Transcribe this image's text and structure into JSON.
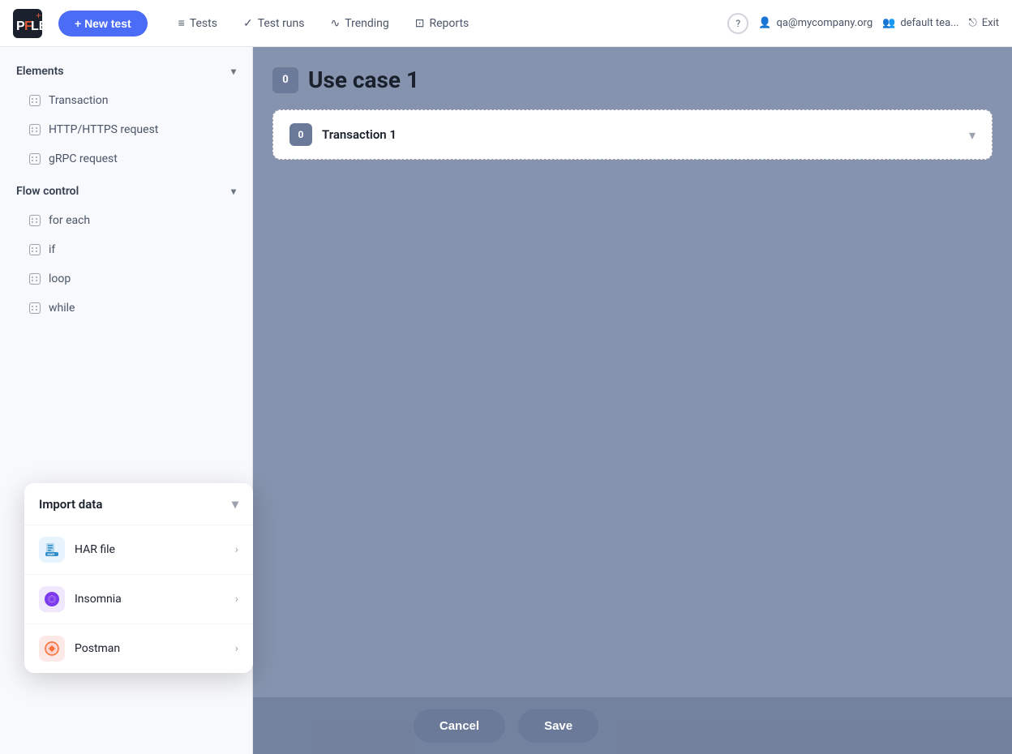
{
  "topnav": {
    "logo_text": "PFLB",
    "new_test_label": "+ New test",
    "nav_items": [
      {
        "id": "tests",
        "label": "Tests",
        "icon": "≡"
      },
      {
        "id": "test-runs",
        "label": "Test runs",
        "icon": "✓"
      },
      {
        "id": "trending",
        "label": "Trending",
        "icon": "∿"
      },
      {
        "id": "reports",
        "label": "Reports",
        "icon": "⊡"
      }
    ],
    "right_items": [
      {
        "id": "help",
        "label": "?",
        "type": "circle"
      },
      {
        "id": "user",
        "label": "qa@mycompany.org",
        "icon": "👤"
      },
      {
        "id": "team",
        "label": "default tea...",
        "icon": "👥"
      },
      {
        "id": "exit",
        "label": "Exit",
        "icon": "⎋"
      }
    ]
  },
  "sidebar": {
    "sections": [
      {
        "id": "elements",
        "label": "Elements",
        "items": [
          {
            "id": "transaction",
            "label": "Transaction"
          },
          {
            "id": "http-request",
            "label": "HTTP/HTTPS request"
          },
          {
            "id": "grpc-request",
            "label": "gRPC request"
          }
        ]
      },
      {
        "id": "flow-control",
        "label": "Flow control",
        "items": [
          {
            "id": "for-each",
            "label": "for each"
          },
          {
            "id": "if",
            "label": "if"
          },
          {
            "id": "loop",
            "label": "loop"
          },
          {
            "id": "while",
            "label": "while"
          }
        ]
      }
    ]
  },
  "main": {
    "use_case_badge": "0",
    "use_case_title": "Use case 1",
    "transaction": {
      "badge": "0",
      "name": "Transaction 1"
    }
  },
  "import_data": {
    "title": "Import data",
    "items": [
      {
        "id": "har-file",
        "label": "HAR file",
        "icon_type": "har"
      },
      {
        "id": "insomnia",
        "label": "Insomnia",
        "icon_type": "insomnia"
      },
      {
        "id": "postman",
        "label": "Postman",
        "icon_type": "postman"
      }
    ]
  },
  "bottom_actions": {
    "cancel_label": "Cancel",
    "save_label": "Save"
  }
}
